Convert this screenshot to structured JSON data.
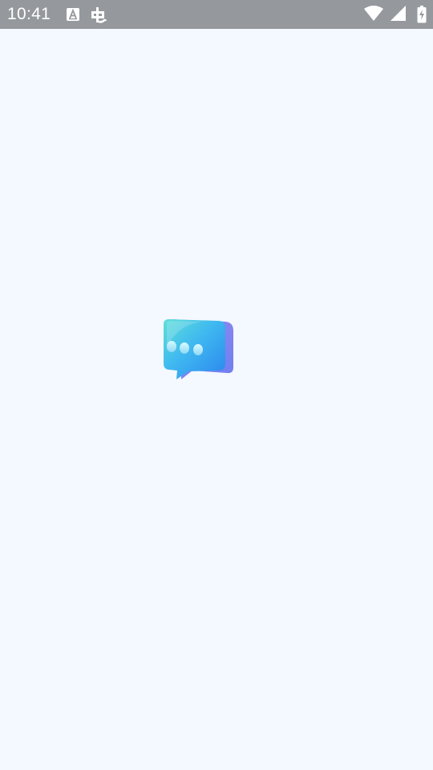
{
  "status_bar": {
    "time": "10:41",
    "background": "#95989c",
    "notifications": [
      "accessibility-a-icon",
      "bug-icon"
    ],
    "system_icons": [
      "wifi-icon",
      "signal-icon",
      "battery-charging-icon"
    ]
  },
  "splash": {
    "background": "#f4f8ff",
    "logo_icon": "chat-bubble-icon",
    "accent": "#2e8cf0"
  }
}
